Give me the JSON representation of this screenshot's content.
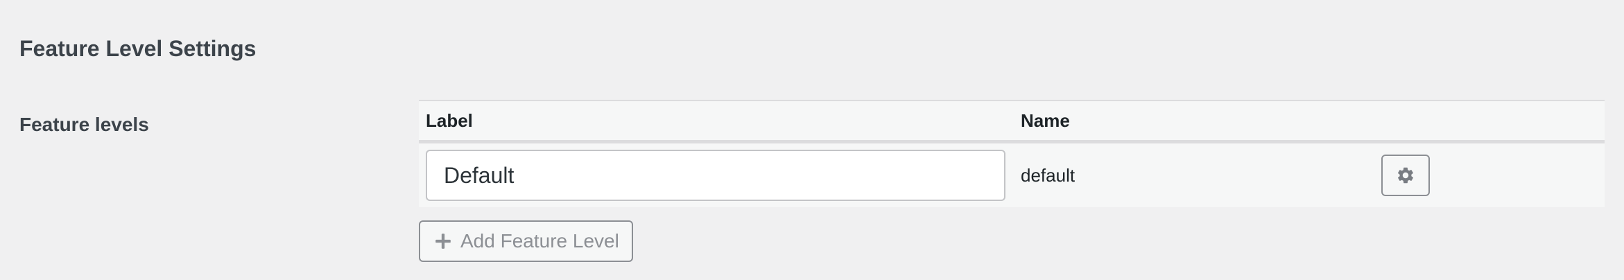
{
  "section": {
    "title": "Feature Level Settings"
  },
  "field": {
    "label": "Feature levels"
  },
  "table": {
    "columns": [
      "Label",
      "Name"
    ],
    "rows": [
      {
        "label_value": "Default",
        "name": "default",
        "action_icon": "gear-icon"
      }
    ]
  },
  "add_button": {
    "label": "Add Feature Level",
    "icon": "plus-icon"
  },
  "colors": {
    "background": "#f0f0f1",
    "table_background": "#f6f7f7",
    "border": "#c3c4c7",
    "muted_text": "#8c8f94"
  }
}
